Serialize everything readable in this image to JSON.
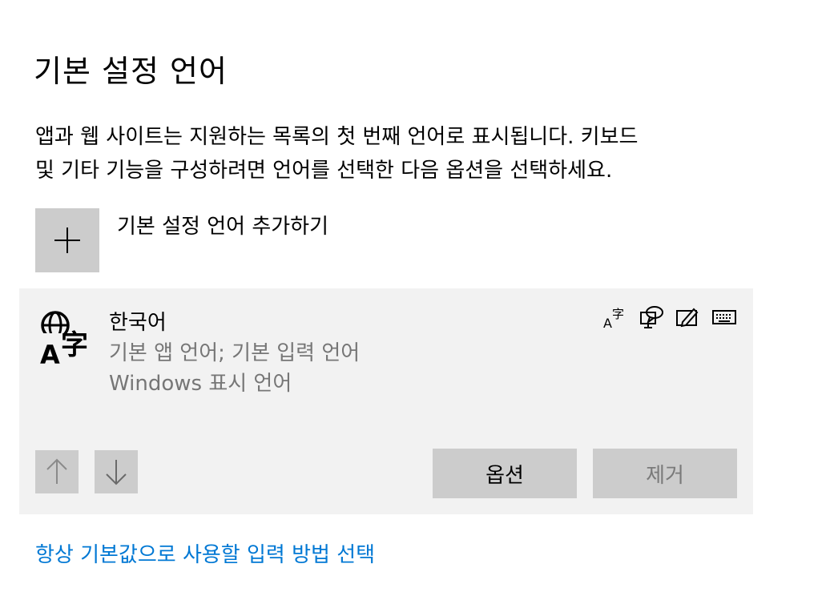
{
  "page": {
    "title": "기본 설정 언어",
    "description_lines": [
      "앱과 웹 사이트는 지원하는 목록의 첫 번째 언어로 표시됩니다. 키보드",
      "및 기타 기능을 구성하려면 언어를 선택한 다음 옵션을 선택하세요."
    ]
  },
  "add_language": {
    "label": "기본 설정 언어 추가하기",
    "icon": "plus-icon"
  },
  "language_item": {
    "name": "한국어",
    "detail_1": "기본 앱 언어; 기본 입력 언어",
    "detail_2": "Windows 표시 언어",
    "icon": "language-icon",
    "features": [
      "language-pack-icon",
      "speech-icon",
      "handwriting-icon",
      "keyboard-icon"
    ],
    "buttons": {
      "move_up_icon": "arrow-up-icon",
      "move_down_icon": "arrow-down-icon",
      "options": "옵션",
      "remove": "제거"
    }
  },
  "footer_link": "항상 기본값으로 사용할 입력 방법 선택",
  "colors": {
    "link": "#0078d4",
    "card_background": "#f2f2f2",
    "button_background": "#cccccc",
    "secondary_text": "#767676"
  }
}
